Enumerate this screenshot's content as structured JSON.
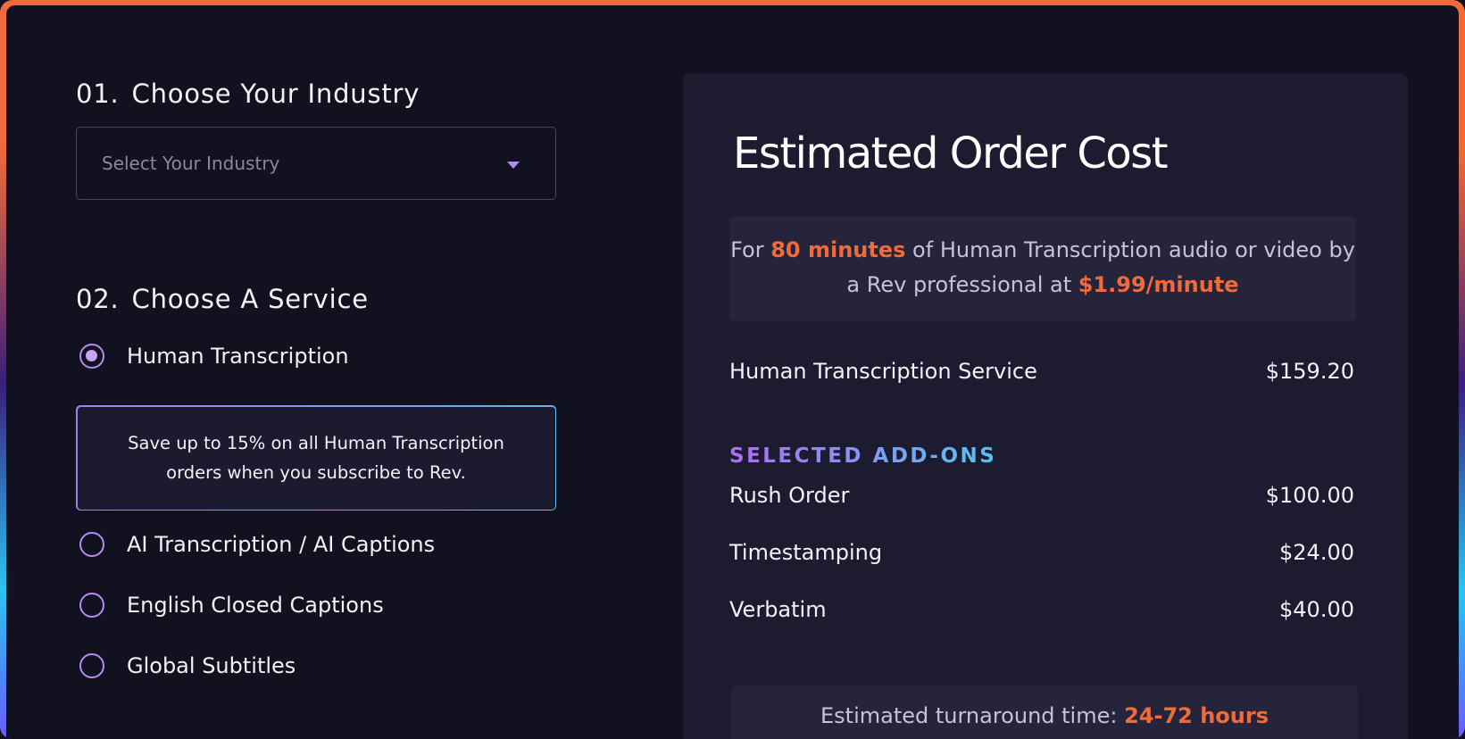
{
  "industry": {
    "step_number": "01.",
    "step_title": "Choose Your Industry",
    "select_placeholder": "Select Your Industry"
  },
  "service": {
    "step_number": "02.",
    "step_title": "Choose A Service",
    "options": [
      {
        "label": "Human Transcription",
        "selected": true
      },
      {
        "label": "AI Transcription / AI Captions",
        "selected": false
      },
      {
        "label": "English Closed Captions",
        "selected": false
      },
      {
        "label": "Global Subtitles",
        "selected": false
      }
    ],
    "promo_text": "Save up to 15% on all Human Transcription orders when you subscribe to Rev."
  },
  "estimate": {
    "title": "Estimated Order Cost",
    "summary": {
      "prefix": "For ",
      "minutes": "80 minutes",
      "middle": " of Human Transcription audio or video by a Rev professional at ",
      "rate": "$1.99/minute"
    },
    "service_line": {
      "label": "Human Transcription Service",
      "amount": "$159.20"
    },
    "addons_heading": "SELECTED ADD-ONS",
    "addons": [
      {
        "label": "Rush Order",
        "amount": "$100.00"
      },
      {
        "label": "Timestamping",
        "amount": "$24.00"
      },
      {
        "label": "Verbatim",
        "amount": "$40.00"
      }
    ],
    "turnaround": {
      "prefix": "Estimated turnaround time: ",
      "value": "24-72 hours"
    }
  },
  "colors": {
    "background": "#12111f",
    "card": "#1d1b2f",
    "accent_orange": "#f06a3a",
    "accent_purple": "#b889f5"
  }
}
